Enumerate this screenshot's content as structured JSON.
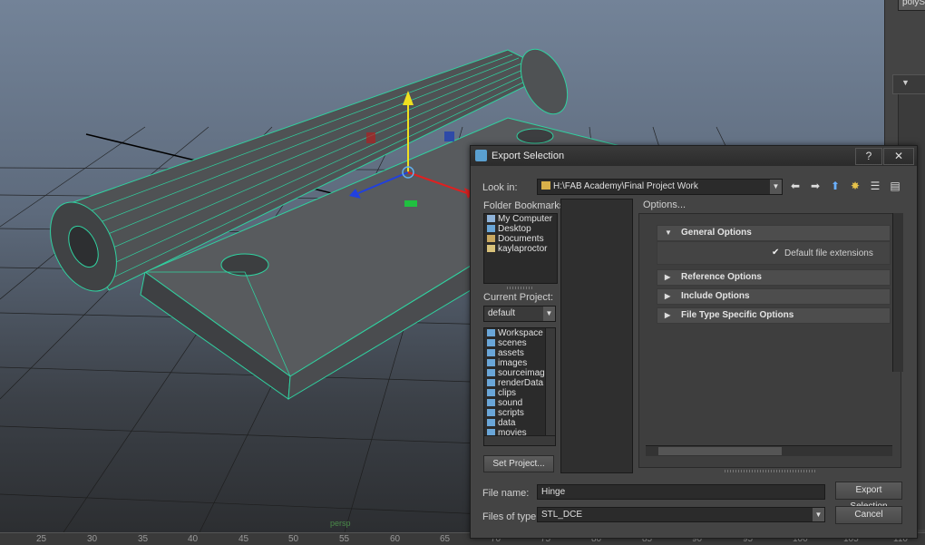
{
  "timeline": {
    "ticks": [
      "25",
      "30",
      "35",
      "40",
      "45",
      "50",
      "55",
      "60",
      "65",
      "70",
      "75",
      "80",
      "85",
      "90",
      "95",
      "100",
      "105",
      "110"
    ]
  },
  "viewport": {
    "camera_label": "persp"
  },
  "right_panel": {
    "tab_label": "polySu"
  },
  "dialog": {
    "title": "Export Selection",
    "help_button": "?",
    "close_button": "✕",
    "look_in_label": "Look in:",
    "look_in_path": "H:\\FAB Academy\\Final Project Work",
    "folder_bookmarks_label": "Folder Bookmarks:",
    "bookmarks": [
      "My Computer",
      "Desktop",
      "Documents",
      "kaylaproctor"
    ],
    "current_project_label": "Current Project:",
    "current_project_value": "default",
    "project_folders": [
      "Workspace F",
      "scenes",
      "assets",
      "images",
      "sourceimage",
      "renderData",
      "clips",
      "sound",
      "scripts",
      "data",
      "movies"
    ],
    "set_project_button": "Set Project...",
    "options_label": "Options...",
    "sections": {
      "general": "General Options",
      "reference": "Reference Options",
      "include": "Include Options",
      "file_type": "File Type Specific Options"
    },
    "default_extensions_label": "Default file extensions",
    "default_extensions_checked": true,
    "file_name_label": "File name:",
    "file_name_value": "Hinge",
    "files_of_type_label": "Files of type:",
    "files_of_type_value": "STL_DCE",
    "export_button": "Export Selection",
    "cancel_button": "Cancel"
  }
}
